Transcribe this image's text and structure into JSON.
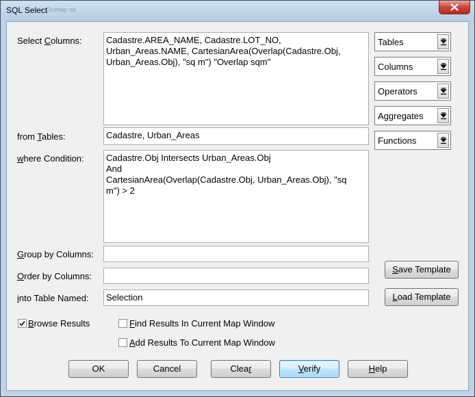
{
  "window": {
    "title": "SQL Select",
    "background_hint": "Overlap sq"
  },
  "labels": {
    "select_columns": [
      "Select ",
      "C",
      "olumns:"
    ],
    "from_tables": [
      "from ",
      "T",
      "ables:"
    ],
    "where_condition": [
      "w",
      "here Condition:"
    ],
    "group_by": [
      "G",
      "roup by Columns:"
    ],
    "order_by": [
      "O",
      "rder by Columns:"
    ],
    "into_table": [
      "i",
      "nto Table Named:"
    ]
  },
  "fields": {
    "select_columns": "Cadastre.AREA_NAME, Cadastre.LOT_NO,\nUrban_Areas.NAME, CartesianArea(Overlap(Cadastre.Obj,\nUrban_Areas.Obj), \"sq m\") \"Overlap sqm\"",
    "from_tables": "Cadastre, Urban_Areas",
    "where_condition": "Cadastre.Obj Intersects Urban_Areas.Obj\nAnd\nCartesianArea(Overlap(Cadastre.Obj, Urban_Areas.Obj), \"sq\nm\") > 2",
    "group_by": "",
    "order_by": "",
    "into_table": "Selection"
  },
  "combos": [
    {
      "label": "Tables",
      "icon": "dropdown-arrow-icon"
    },
    {
      "label": "Columns",
      "icon": "dropdown-arrow-icon"
    },
    {
      "label": "Operators",
      "icon": "dropdown-arrow-icon"
    },
    {
      "label": "Aggregates",
      "icon": "dropdown-arrow-icon"
    },
    {
      "label": "Functions",
      "icon": "dropdown-arrow-icon"
    }
  ],
  "template_buttons": {
    "save": [
      "S",
      "ave Template"
    ],
    "load": [
      "L",
      "oad Template"
    ]
  },
  "checkboxes": {
    "browse": {
      "label": [
        "B",
        "rowse Results"
      ],
      "checked": true
    },
    "find": {
      "label": [
        "F",
        "ind Results In Current Map Window"
      ],
      "checked": false
    },
    "add": {
      "label": [
        "A",
        "dd Results To Current Map Window"
      ],
      "checked": false
    }
  },
  "buttons": {
    "ok": "OK",
    "cancel": "Cancel",
    "clear": [
      "Clea",
      "r",
      ""
    ],
    "verify": [
      "",
      "V",
      "erify"
    ],
    "help": [
      "",
      "H",
      "elp"
    ]
  },
  "colors": {
    "title_bar": "#bcd3e8",
    "close_button": "#c9453a",
    "dialog_face": "#f0f0f0",
    "default_button": "#3c7fb1"
  }
}
